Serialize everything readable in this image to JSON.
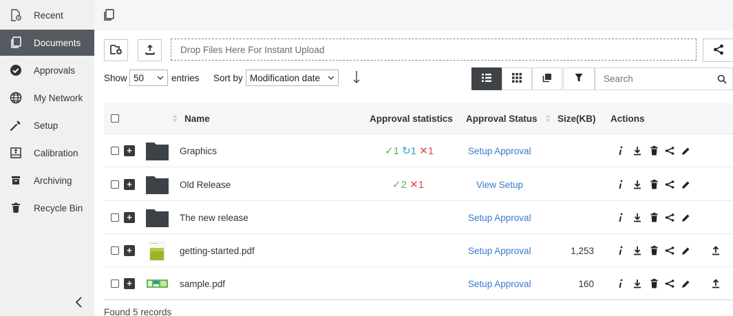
{
  "sidebar": {
    "items": [
      {
        "label": "Recent",
        "icon": "recent-doc-icon"
      },
      {
        "label": "Documents",
        "icon": "documents-icon",
        "active": true
      },
      {
        "label": "Approvals",
        "icon": "approval-check-icon"
      },
      {
        "label": "My Network",
        "icon": "globe-icon"
      },
      {
        "label": "Setup",
        "icon": "wrench-icon"
      },
      {
        "label": "Calibration",
        "icon": "calibration-icon"
      },
      {
        "label": "Archiving",
        "icon": "archive-icon"
      },
      {
        "label": "Recycle Bin",
        "icon": "trash-icon"
      }
    ],
    "collapse_icon": "chevron-left-icon"
  },
  "toolbar": {
    "dropzone_text": "Drop Files Here For Instant Upload"
  },
  "controls": {
    "show_label": "Show",
    "entries_value": "50",
    "entries_label": "entries",
    "sort_label": "Sort by",
    "sort_value": "Modification date"
  },
  "search": {
    "placeholder": "Search"
  },
  "table": {
    "headers": {
      "name": "Name",
      "approval_statistics": "Approval statistics",
      "approval_status": "Approval Status",
      "size": "Size(KB)",
      "actions": "Actions"
    },
    "rows": [
      {
        "name": "Graphics",
        "type": "folder",
        "stats": {
          "approved": "1",
          "pending": "1",
          "rejected": "1"
        },
        "status": "Setup Approval",
        "size": "",
        "has_upload": false
      },
      {
        "name": "Old Release",
        "type": "folder",
        "stats": {
          "approved": "2",
          "pending": "",
          "rejected": "1"
        },
        "status": "View Setup",
        "size": "",
        "has_upload": false
      },
      {
        "name": "The new release",
        "type": "folder",
        "stats": {
          "approved": "",
          "pending": "",
          "rejected": ""
        },
        "status": "Setup Approval",
        "size": "",
        "has_upload": false
      },
      {
        "name": "getting-started.pdf",
        "type": "pdf-green",
        "stats": {
          "approved": "",
          "pending": "",
          "rejected": ""
        },
        "status": "Setup Approval",
        "size": "1,253",
        "has_upload": true
      },
      {
        "name": "sample.pdf",
        "type": "pdf-sample",
        "stats": {
          "approved": "",
          "pending": "",
          "rejected": ""
        },
        "status": "Setup Approval",
        "size": "160",
        "has_upload": true
      }
    ]
  },
  "footer": {
    "records_text": "Found 5 records"
  },
  "colors": {
    "sidebar_bg": "#f0f0f0",
    "sidebar_active": "#555a60",
    "link": "#3a7bc8",
    "approved": "#5ab64a",
    "pending": "#2f9fd8",
    "rejected": "#e04848"
  }
}
